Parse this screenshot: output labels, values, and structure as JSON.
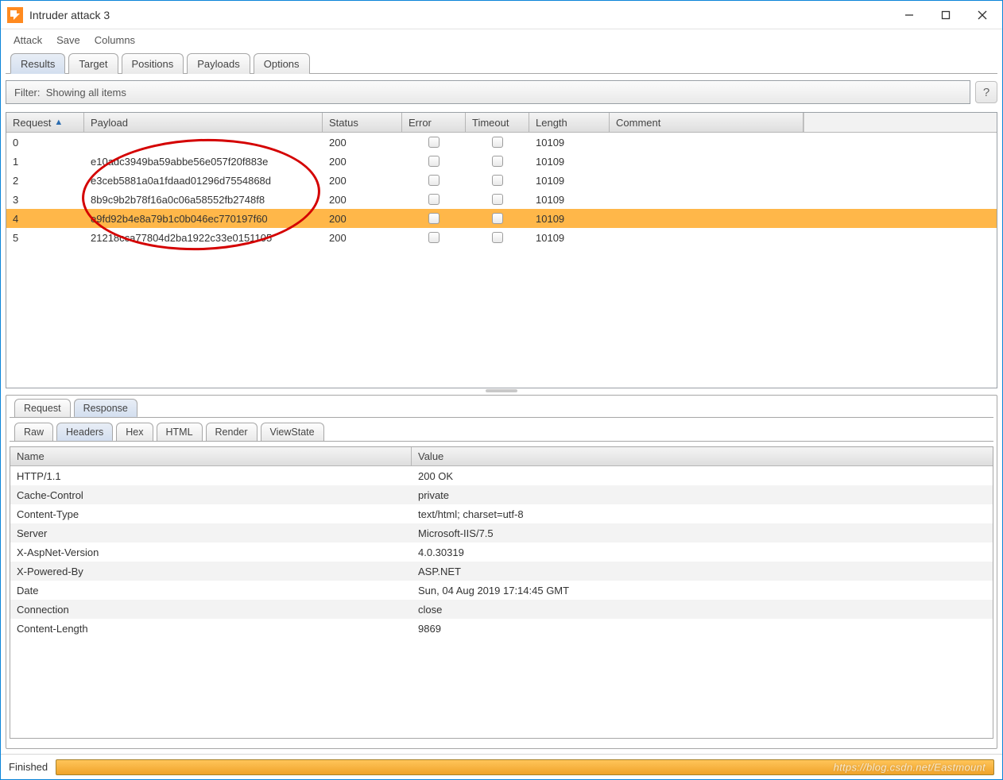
{
  "window": {
    "title": "Intruder attack 3"
  },
  "menu": {
    "items": [
      "Attack",
      "Save",
      "Columns"
    ]
  },
  "mainTabs": {
    "items": [
      "Results",
      "Target",
      "Positions",
      "Payloads",
      "Options"
    ],
    "activeIndex": 0
  },
  "filter": {
    "label": "Filter:",
    "text": "Showing all items"
  },
  "resultsTable": {
    "columns": [
      "Request",
      "Payload",
      "Status",
      "Error",
      "Timeout",
      "Length",
      "Comment"
    ],
    "sortColumn": 0,
    "rows": [
      {
        "request": "0",
        "payload": "",
        "status": "200",
        "error": false,
        "timeout": false,
        "length": "10109",
        "comment": "",
        "selected": false
      },
      {
        "request": "1",
        "payload": "e10adc3949ba59abbe56e057f20f883e",
        "status": "200",
        "error": false,
        "timeout": false,
        "length": "10109",
        "comment": "",
        "selected": false
      },
      {
        "request": "2",
        "payload": "e3ceb5881a0a1fdaad01296d7554868d",
        "status": "200",
        "error": false,
        "timeout": false,
        "length": "10109",
        "comment": "",
        "selected": false
      },
      {
        "request": "3",
        "payload": "8b9c9b2b78f16a0c06a58552fb2748f8",
        "status": "200",
        "error": false,
        "timeout": false,
        "length": "10109",
        "comment": "",
        "selected": false
      },
      {
        "request": "4",
        "payload": "e9fd92b4e8a79b1c0b046ec770197f60",
        "status": "200",
        "error": false,
        "timeout": false,
        "length": "10109",
        "comment": "",
        "selected": true
      },
      {
        "request": "5",
        "payload": "21218cca77804d2ba1922c33e0151105",
        "status": "200",
        "error": false,
        "timeout": false,
        "length": "10109",
        "comment": "",
        "selected": false
      }
    ]
  },
  "subTabs": {
    "items": [
      "Request",
      "Response"
    ],
    "activeIndex": 1
  },
  "viewTabs": {
    "items": [
      "Raw",
      "Headers",
      "Hex",
      "HTML",
      "Render",
      "ViewState"
    ],
    "activeIndex": 1
  },
  "headersTable": {
    "columns": [
      "Name",
      "Value"
    ],
    "rows": [
      {
        "name": "HTTP/1.1",
        "value": "200 OK"
      },
      {
        "name": "Cache-Control",
        "value": "private"
      },
      {
        "name": "Content-Type",
        "value": "text/html; charset=utf-8"
      },
      {
        "name": "Server",
        "value": "Microsoft-IIS/7.5"
      },
      {
        "name": "X-AspNet-Version",
        "value": "4.0.30319"
      },
      {
        "name": "X-Powered-By",
        "value": "ASP.NET"
      },
      {
        "name": "Date",
        "value": "Sun, 04 Aug 2019 17:14:45 GMT"
      },
      {
        "name": "Connection",
        "value": "close"
      },
      {
        "name": "Content-Length",
        "value": "9869"
      }
    ]
  },
  "status": {
    "label": "Finished"
  },
  "watermark": "https://blog.csdn.net/Eastmount"
}
